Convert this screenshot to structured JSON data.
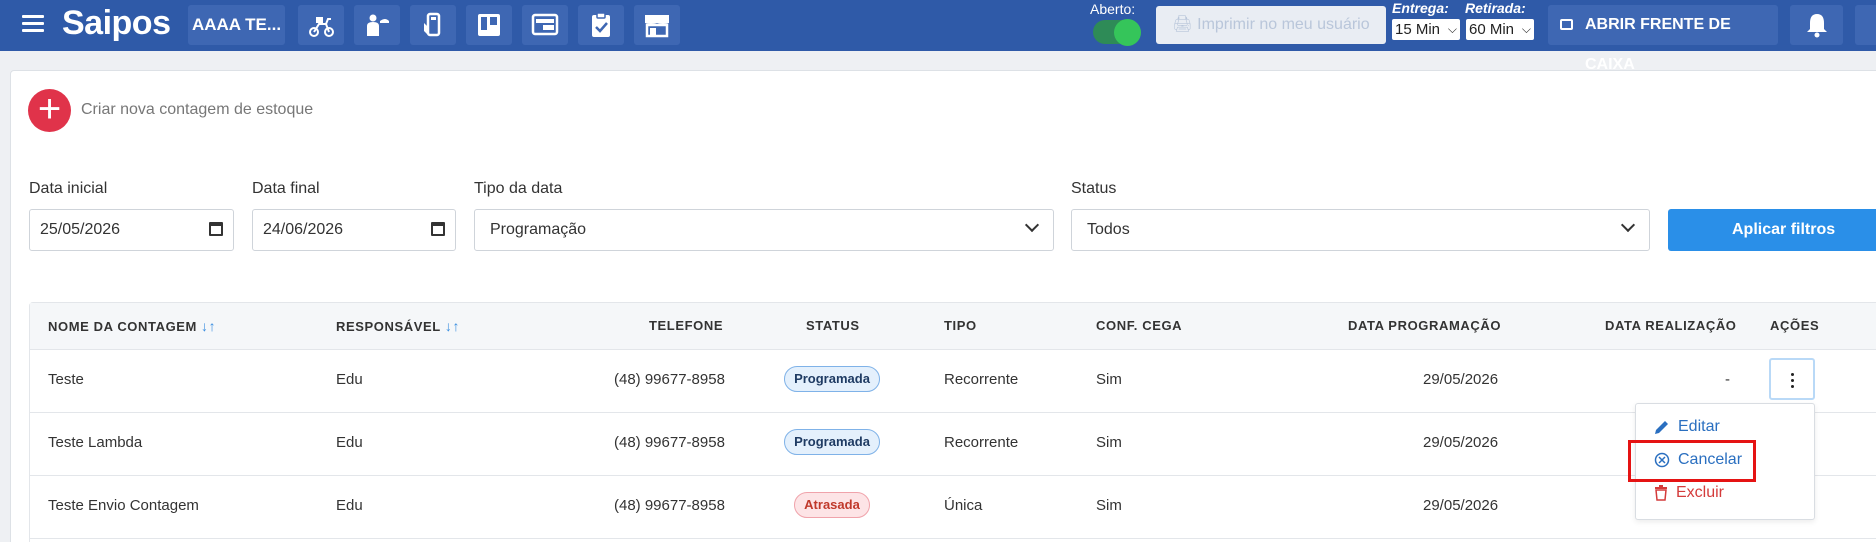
{
  "app": {
    "logo": "Saipos",
    "store_button": "AAAA TE..."
  },
  "topbar": {
    "icons": [
      "delivery-moto-icon",
      "waiter-icon",
      "phone-order-icon",
      "kanban-icon",
      "table-icon",
      "checklist-icon",
      "store-icon"
    ],
    "aberto_label": "Aberto:",
    "print_button": "Imprimir no meu usuário",
    "entrega_label": "Entrega:",
    "entrega_value": "15 Min",
    "retirada_label": "Retirada:",
    "retirada_value": "60 Min",
    "caixa_button": "ABRIR FRENTE DE CAIXA",
    "colors": {
      "bar": "#2f5aa8",
      "toggle_on": "#35c55a"
    }
  },
  "create": {
    "label": "Criar nova contagem de estoque"
  },
  "filters": {
    "data_inicial_label": "Data inicial",
    "data_inicial_value": "25/05/2026",
    "data_final_label": "Data final",
    "data_final_value": "24/06/2026",
    "tipo_label": "Tipo da data",
    "tipo_value": "Programação",
    "status_label": "Status",
    "status_value": "Todos",
    "apply_button": "Aplicar filtros"
  },
  "table": {
    "headers": {
      "nome": "NOME DA CONTAGEM",
      "responsavel": "RESPONSÁVEL",
      "telefone": "TELEFONE",
      "status": "STATUS",
      "tipo": "TIPO",
      "conf_cega": "CONF. CEGA",
      "data_programacao": "DATA PROGRAMAÇÃO",
      "data_realizacao": "DATA REALIZAÇÃO",
      "acoes": "AÇÕES"
    },
    "rows": [
      {
        "nome": "Teste",
        "responsavel": "Edu",
        "telefone": "(48) 99677-8958",
        "status": "Programada",
        "tipo": "Recorrente",
        "conf_cega": "Sim",
        "data_programacao": "29/05/2026",
        "data_realizacao": "-"
      },
      {
        "nome": "Teste Lambda",
        "responsavel": "Edu",
        "telefone": "(48) 99677-8958",
        "status": "Programada",
        "tipo": "Recorrente",
        "conf_cega": "Sim",
        "data_programacao": "29/05/2026",
        "data_realizacao": ""
      },
      {
        "nome": "Teste Envio Contagem",
        "responsavel": "Edu",
        "telefone": "(48) 99677-8958",
        "status": "Atrasada",
        "tipo": "Única",
        "conf_cega": "Sim",
        "data_programacao": "29/05/2026",
        "data_realizacao": ""
      }
    ]
  },
  "menu": {
    "edit": "Editar",
    "cancel": "Cancelar",
    "delete": "Excluir"
  }
}
